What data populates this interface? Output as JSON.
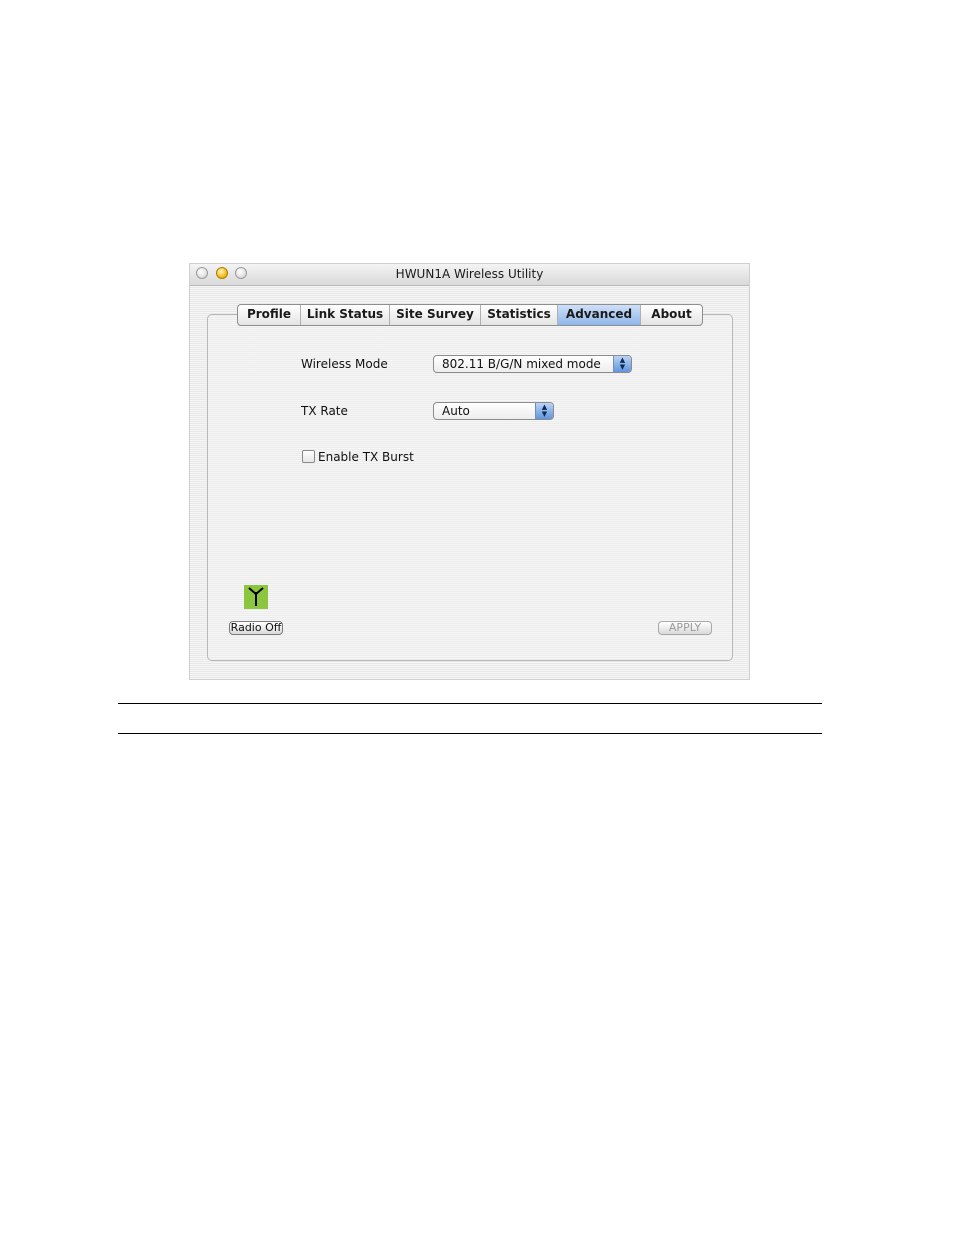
{
  "window": {
    "title": "HWUN1A  Wireless Utility"
  },
  "tabs": [
    {
      "label": "Profile"
    },
    {
      "label": "Link Status"
    },
    {
      "label": "Site Survey"
    },
    {
      "label": "Statistics"
    },
    {
      "label": "Advanced",
      "active": true
    },
    {
      "label": "About"
    }
  ],
  "advanced": {
    "wireless_mode": {
      "label": "Wireless Mode",
      "value": "802.11 B/G/N mixed mode"
    },
    "tx_rate": {
      "label": "TX Rate",
      "value": "Auto"
    },
    "tx_burst": {
      "label": "Enable TX Burst",
      "checked": false
    }
  },
  "footer": {
    "radio_button": "Radio Off",
    "apply_button": "APPLY"
  },
  "icons": {
    "antenna": "antenna-icon",
    "popup_arrows": "updown-arrows-icon"
  },
  "colors": {
    "active_tab": "#8fb6ea",
    "antenna_bg": "#8cc63e"
  }
}
